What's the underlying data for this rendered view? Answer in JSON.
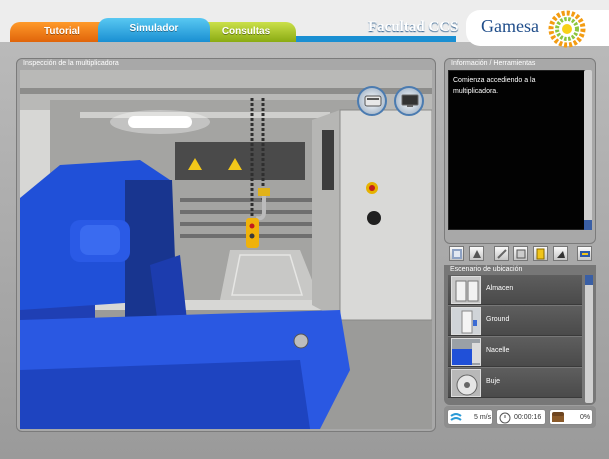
{
  "header": {
    "tabs": [
      {
        "label": "Tutorial"
      },
      {
        "label": "Simulador"
      },
      {
        "label": "Consultas"
      }
    ],
    "faculty": "Facultad CCS",
    "brand": "Gamesa",
    "colors": {
      "tutorial": "#f07a18",
      "simulador": "#2aa0e0",
      "consultas": "#a8c41e",
      "brand": "#1f4d8a"
    }
  },
  "scene": {
    "title": "Inspección de la multiplicadora",
    "buttons": [
      {
        "icon": "device-icon"
      },
      {
        "icon": "monitor-icon"
      }
    ]
  },
  "info": {
    "title": "Información / Herramientas",
    "text": "Comienza accediendo a la multiplicadora."
  },
  "tools": [
    {
      "icon": "tool-1-icon"
    },
    {
      "icon": "tool-2-icon"
    },
    {
      "icon": "tool-3-icon"
    },
    {
      "icon": "tool-4-icon"
    },
    {
      "icon": "tool-5-icon"
    },
    {
      "icon": "tool-6-icon"
    },
    {
      "icon": "tool-7-icon"
    }
  ],
  "locations": {
    "title": "Escenario de ubicación",
    "items": [
      {
        "label": "Almacen"
      },
      {
        "label": "Ground"
      },
      {
        "label": "Nacelle"
      },
      {
        "label": "Buje"
      }
    ]
  },
  "status": {
    "wind": "5 m/s",
    "time": "00:00:16",
    "progress": "0%"
  }
}
